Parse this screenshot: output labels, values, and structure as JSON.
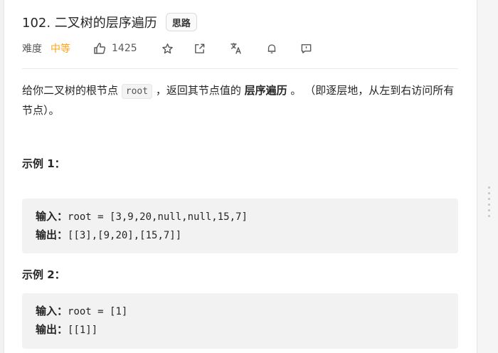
{
  "problem": {
    "title": "102. 二叉树的层序遍历",
    "hint_button": "思路"
  },
  "meta": {
    "difficulty_label": "难度",
    "difficulty_value": "中等",
    "difficulty_color": "#ffa116",
    "like_count": "1425",
    "icons": [
      "thumbs-up-icon",
      "star-icon",
      "share-icon",
      "translate-icon",
      "bell-icon",
      "feedback-icon"
    ]
  },
  "description": {
    "part1": "给你二叉树的根节点 ",
    "code": "root",
    "part2": " ，返回其节点值的 ",
    "bold": "层序遍历",
    "part3": " 。 （即逐层地，从左到右访问所有节点）。"
  },
  "examples": [
    {
      "title": "示例 1：",
      "input_label": "输入：",
      "input_value": "root = [3,9,20,null,null,15,7]",
      "output_label": "输出：",
      "output_value": "[[3],[9,20],[15,7]]"
    },
    {
      "title": "示例 2：",
      "input_label": "输入：",
      "input_value": "root = [1]",
      "output_label": "输出：",
      "output_value": "[[1]]"
    }
  ]
}
